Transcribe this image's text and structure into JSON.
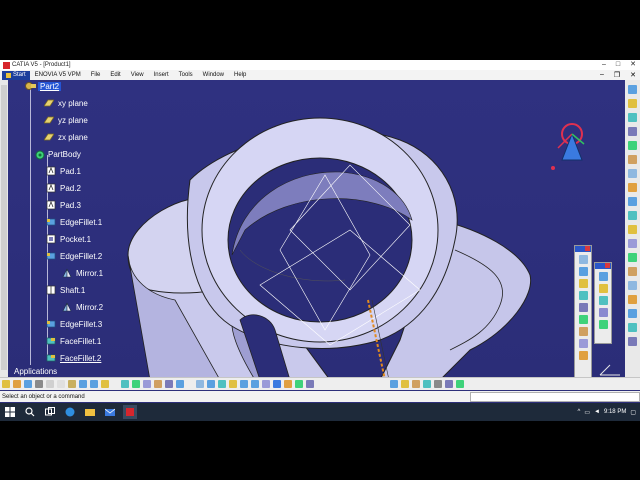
{
  "window": {
    "title": "CATIA V5 - [Product1]"
  },
  "menubar": {
    "start_label": "Start",
    "items": [
      "ENOVIA V5 VPM",
      "File",
      "Edit",
      "View",
      "Insert",
      "Tools",
      "Window",
      "Help"
    ]
  },
  "tree": {
    "part": "Part2",
    "planes": [
      "xy plane",
      "yz plane",
      "zx plane"
    ],
    "body": "PartBody",
    "features": [
      "Pad.1",
      "Pad.2",
      "Pad.3",
      "EdgeFillet.1",
      "Pocket.1",
      "EdgeFillet.2",
      "Mirror.1",
      "Shaft.1",
      "Mirror.2",
      "EdgeFillet.3",
      "FaceFillet.1",
      "FaceFillet.2"
    ],
    "applications": "Applications"
  },
  "status": {
    "message": "Select an object or a command"
  },
  "taskbar": {
    "time": "9:18 PM"
  },
  "colors": {
    "background": "#2d2f7a",
    "part_fill": "#cfcfee",
    "part_shade": "#a8a8d8",
    "selection": "#2455d5",
    "taskbar": "#1e2a3a"
  }
}
